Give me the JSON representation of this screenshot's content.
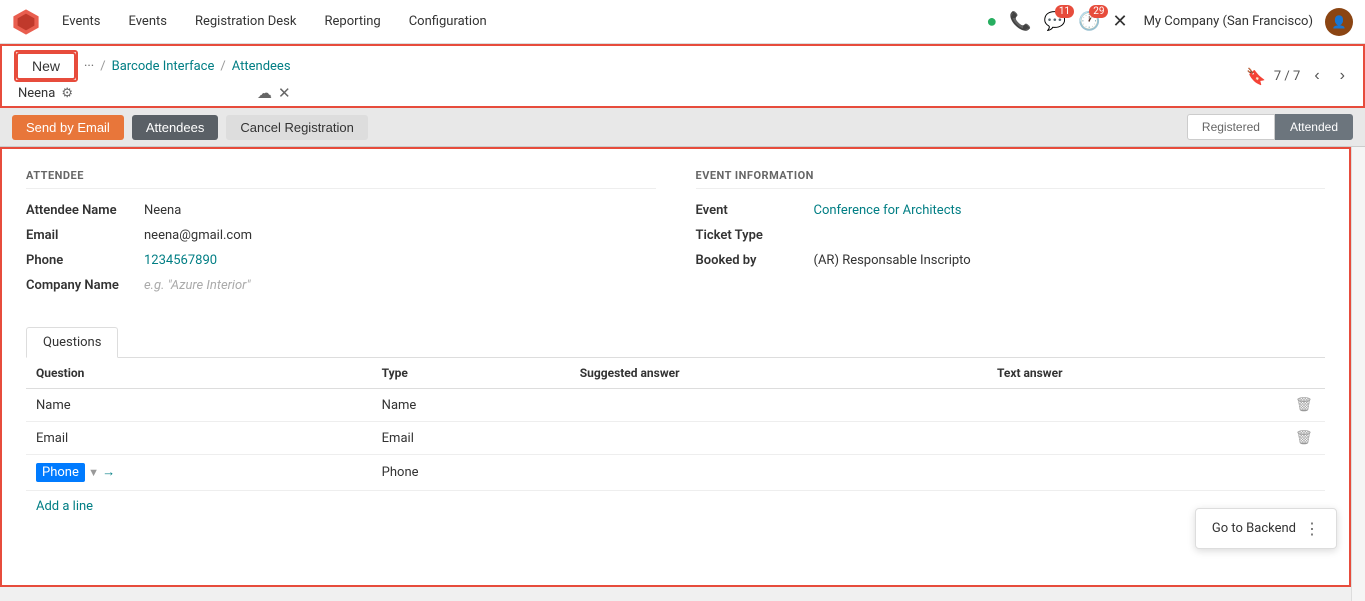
{
  "nav": {
    "logo_alt": "Odoo Logo",
    "items": [
      "Events",
      "Events",
      "Registration Desk",
      "Reporting",
      "Configuration"
    ],
    "badge_messages": "11",
    "badge_activity": "29",
    "company": "My Company (San Francisco)"
  },
  "toolbar": {
    "new_label": "New",
    "dots": "···",
    "breadcrumb": {
      "link1": "Barcode Interface",
      "sep": "/",
      "link2": "Attendees"
    },
    "record_name": "Neena",
    "pagination": "7 / 7"
  },
  "action_buttons": {
    "send_by_email": "Send by Email",
    "attendees": "Attendees",
    "cancel_registration": "Cancel Registration",
    "status_registered": "Registered",
    "status_attended": "Attended"
  },
  "attendee_section": {
    "title": "ATTENDEE",
    "fields": [
      {
        "label": "Attendee Name",
        "value": "Neena",
        "type": "text"
      },
      {
        "label": "Email",
        "value": "neena@gmail.com",
        "type": "text"
      },
      {
        "label": "Phone",
        "value": "1234567890",
        "type": "phone"
      },
      {
        "label": "Company Name",
        "value": "e.g. \"Azure Interior\"",
        "type": "placeholder"
      }
    ]
  },
  "event_section": {
    "title": "EVENT INFORMATION",
    "fields": [
      {
        "label": "Event",
        "value": "Conference for Architects",
        "type": "link"
      },
      {
        "label": "Ticket Type",
        "value": "",
        "type": "text"
      },
      {
        "label": "Booked by",
        "value": "(AR) Responsable Inscripto",
        "type": "text"
      }
    ]
  },
  "questions_tab": {
    "tab_label": "Questions",
    "columns": [
      "Question",
      "Type",
      "Suggested answer",
      "Text answer"
    ],
    "rows": [
      {
        "question": "Name",
        "type": "Name",
        "suggested": "",
        "text": ""
      },
      {
        "question": "Email",
        "type": "Email",
        "suggested": "",
        "text": ""
      },
      {
        "question": "Phone",
        "type": "Phone",
        "suggested": "",
        "text": "",
        "selected": true
      }
    ],
    "add_line": "Add a line"
  },
  "go_backend": {
    "label": "Go to Backend"
  }
}
